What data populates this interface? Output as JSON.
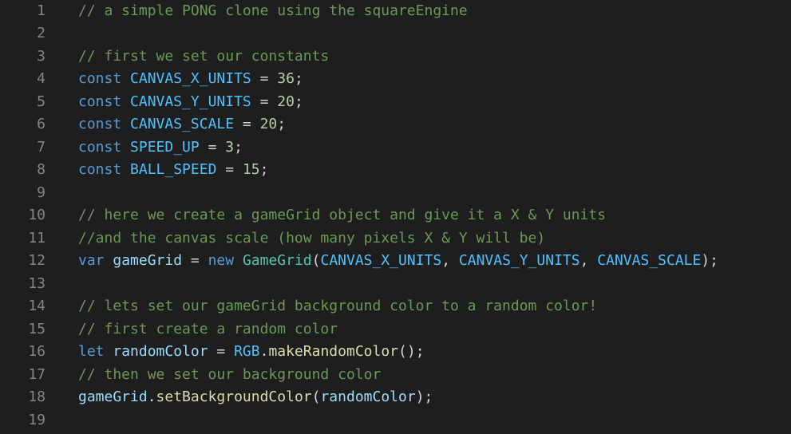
{
  "editor": {
    "background": "#1e1e1e",
    "lines": [
      {
        "number": "1",
        "tokens": [
          {
            "t": "// a simple PONG clone using the squareEngine",
            "k": "comment"
          }
        ]
      },
      {
        "number": "2",
        "tokens": []
      },
      {
        "number": "3",
        "tokens": [
          {
            "t": "// first we set our constants",
            "k": "comment"
          }
        ]
      },
      {
        "number": "4",
        "tokens": [
          {
            "t": "const",
            "k": "keyword"
          },
          {
            "t": " ",
            "k": "plain"
          },
          {
            "t": "CANVAS_X_UNITS",
            "k": "const"
          },
          {
            "t": " = ",
            "k": "op"
          },
          {
            "t": "36",
            "k": "num"
          },
          {
            "t": ";",
            "k": "punct"
          }
        ]
      },
      {
        "number": "5",
        "tokens": [
          {
            "t": "const",
            "k": "keyword"
          },
          {
            "t": " ",
            "k": "plain"
          },
          {
            "t": "CANVAS_Y_UNITS",
            "k": "const"
          },
          {
            "t": " = ",
            "k": "op"
          },
          {
            "t": "20",
            "k": "num"
          },
          {
            "t": ";",
            "k": "punct"
          }
        ]
      },
      {
        "number": "6",
        "tokens": [
          {
            "t": "const",
            "k": "keyword"
          },
          {
            "t": " ",
            "k": "plain"
          },
          {
            "t": "CANVAS_SCALE",
            "k": "const"
          },
          {
            "t": " = ",
            "k": "op"
          },
          {
            "t": "20",
            "k": "num"
          },
          {
            "t": ";",
            "k": "punct"
          }
        ]
      },
      {
        "number": "7",
        "tokens": [
          {
            "t": "const",
            "k": "keyword"
          },
          {
            "t": " ",
            "k": "plain"
          },
          {
            "t": "SPEED_UP",
            "k": "const"
          },
          {
            "t": " = ",
            "k": "op"
          },
          {
            "t": "3",
            "k": "num"
          },
          {
            "t": ";",
            "k": "punct"
          }
        ]
      },
      {
        "number": "8",
        "tokens": [
          {
            "t": "const",
            "k": "keyword"
          },
          {
            "t": " ",
            "k": "plain"
          },
          {
            "t": "BALL_SPEED",
            "k": "const"
          },
          {
            "t": " = ",
            "k": "op"
          },
          {
            "t": "15",
            "k": "num"
          },
          {
            "t": ";",
            "k": "punct"
          }
        ]
      },
      {
        "number": "9",
        "tokens": []
      },
      {
        "number": "10",
        "tokens": [
          {
            "t": "// here we create a gameGrid object and give it a X & Y units",
            "k": "comment"
          }
        ]
      },
      {
        "number": "11",
        "tokens": [
          {
            "t": "//and the canvas scale (how many pixels X & Y will be)",
            "k": "comment"
          }
        ]
      },
      {
        "number": "12",
        "tokens": [
          {
            "t": "var",
            "k": "keyword"
          },
          {
            "t": " ",
            "k": "plain"
          },
          {
            "t": "gameGrid",
            "k": "var"
          },
          {
            "t": " = ",
            "k": "op"
          },
          {
            "t": "new",
            "k": "keyword"
          },
          {
            "t": " ",
            "k": "plain"
          },
          {
            "t": "GameGrid",
            "k": "class"
          },
          {
            "t": "(",
            "k": "punct"
          },
          {
            "t": "CANVAS_X_UNITS",
            "k": "const"
          },
          {
            "t": ", ",
            "k": "punct"
          },
          {
            "t": "CANVAS_Y_UNITS",
            "k": "const"
          },
          {
            "t": ", ",
            "k": "punct"
          },
          {
            "t": "CANVAS_SCALE",
            "k": "const"
          },
          {
            "t": ");",
            "k": "punct"
          }
        ]
      },
      {
        "number": "13",
        "tokens": []
      },
      {
        "number": "14",
        "tokens": [
          {
            "t": "// lets set our gameGrid background color to a random color!",
            "k": "comment"
          }
        ]
      },
      {
        "number": "15",
        "tokens": [
          {
            "t": "// first create a random color",
            "k": "comment"
          }
        ]
      },
      {
        "number": "16",
        "tokens": [
          {
            "t": "let",
            "k": "keyword"
          },
          {
            "t": " ",
            "k": "plain"
          },
          {
            "t": "randomColor",
            "k": "var"
          },
          {
            "t": " = ",
            "k": "op"
          },
          {
            "t": "RGB",
            "k": "const"
          },
          {
            "t": ".",
            "k": "punct"
          },
          {
            "t": "makeRandomColor",
            "k": "func"
          },
          {
            "t": "();",
            "k": "punct"
          }
        ]
      },
      {
        "number": "17",
        "tokens": [
          {
            "t": "// then we set our background color",
            "k": "comment"
          }
        ]
      },
      {
        "number": "18",
        "tokens": [
          {
            "t": "gameGrid",
            "k": "var"
          },
          {
            "t": ".",
            "k": "punct"
          },
          {
            "t": "setBackgroundColor",
            "k": "func"
          },
          {
            "t": "(",
            "k": "punct"
          },
          {
            "t": "randomColor",
            "k": "var"
          },
          {
            "t": ");",
            "k": "punct"
          }
        ]
      },
      {
        "number": "19",
        "tokens": []
      }
    ]
  }
}
